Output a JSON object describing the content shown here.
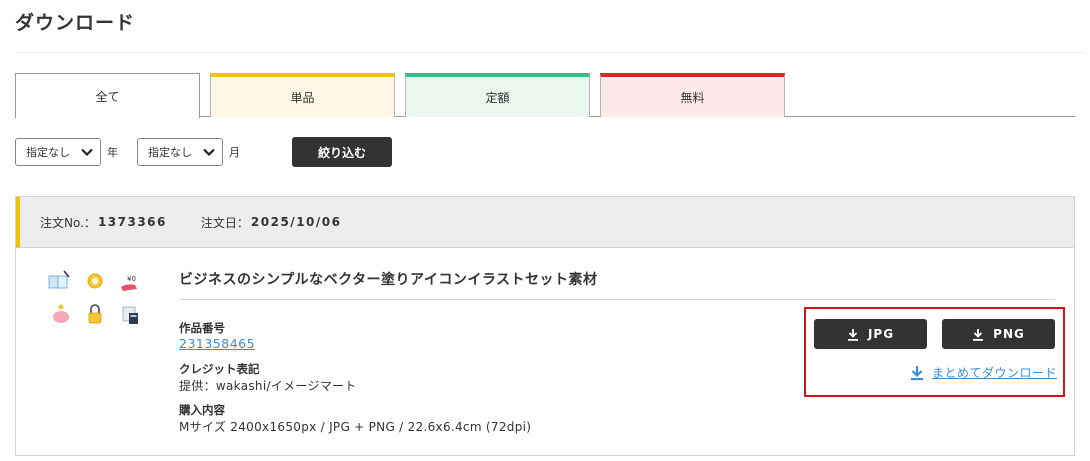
{
  "page": {
    "title": "ダウンロード"
  },
  "tabs": [
    {
      "label": "全て",
      "active": true
    },
    {
      "label": "単品",
      "accent": "#f2c100"
    },
    {
      "label": "定額",
      "accent": "#2cc08b"
    },
    {
      "label": "無料",
      "accent": "#e02424"
    }
  ],
  "filter": {
    "year_select": "指定なし",
    "year_unit": "年",
    "month_select": "指定なし",
    "month_unit": "月",
    "submit_label": "絞り込む"
  },
  "order": {
    "number_label": "注文No.：",
    "number": "1373366",
    "date_label": "注文日：",
    "date": "2025/10/06",
    "item": {
      "title": "ビジネスのシンプルなベクター塗りアイコンイラストセット素材",
      "work_number_label": "作品番号",
      "work_number": "231358465",
      "credit_label": "クレジット表記",
      "credit_value": "提供：wakashi/イメージマート",
      "purchase_label": "購入内容",
      "purchase_value": "Mサイズ 2400x1650px / JPG + PNG / 22.6x6.4cm (72dpi)"
    },
    "download": {
      "jpg_label": "JPG",
      "png_label": "PNG",
      "bulk_label": "まとめてダウンロード"
    }
  },
  "colors": {
    "highlight_box": "#d0161c",
    "link": "#3a8fd0",
    "button_bg": "#333333"
  }
}
